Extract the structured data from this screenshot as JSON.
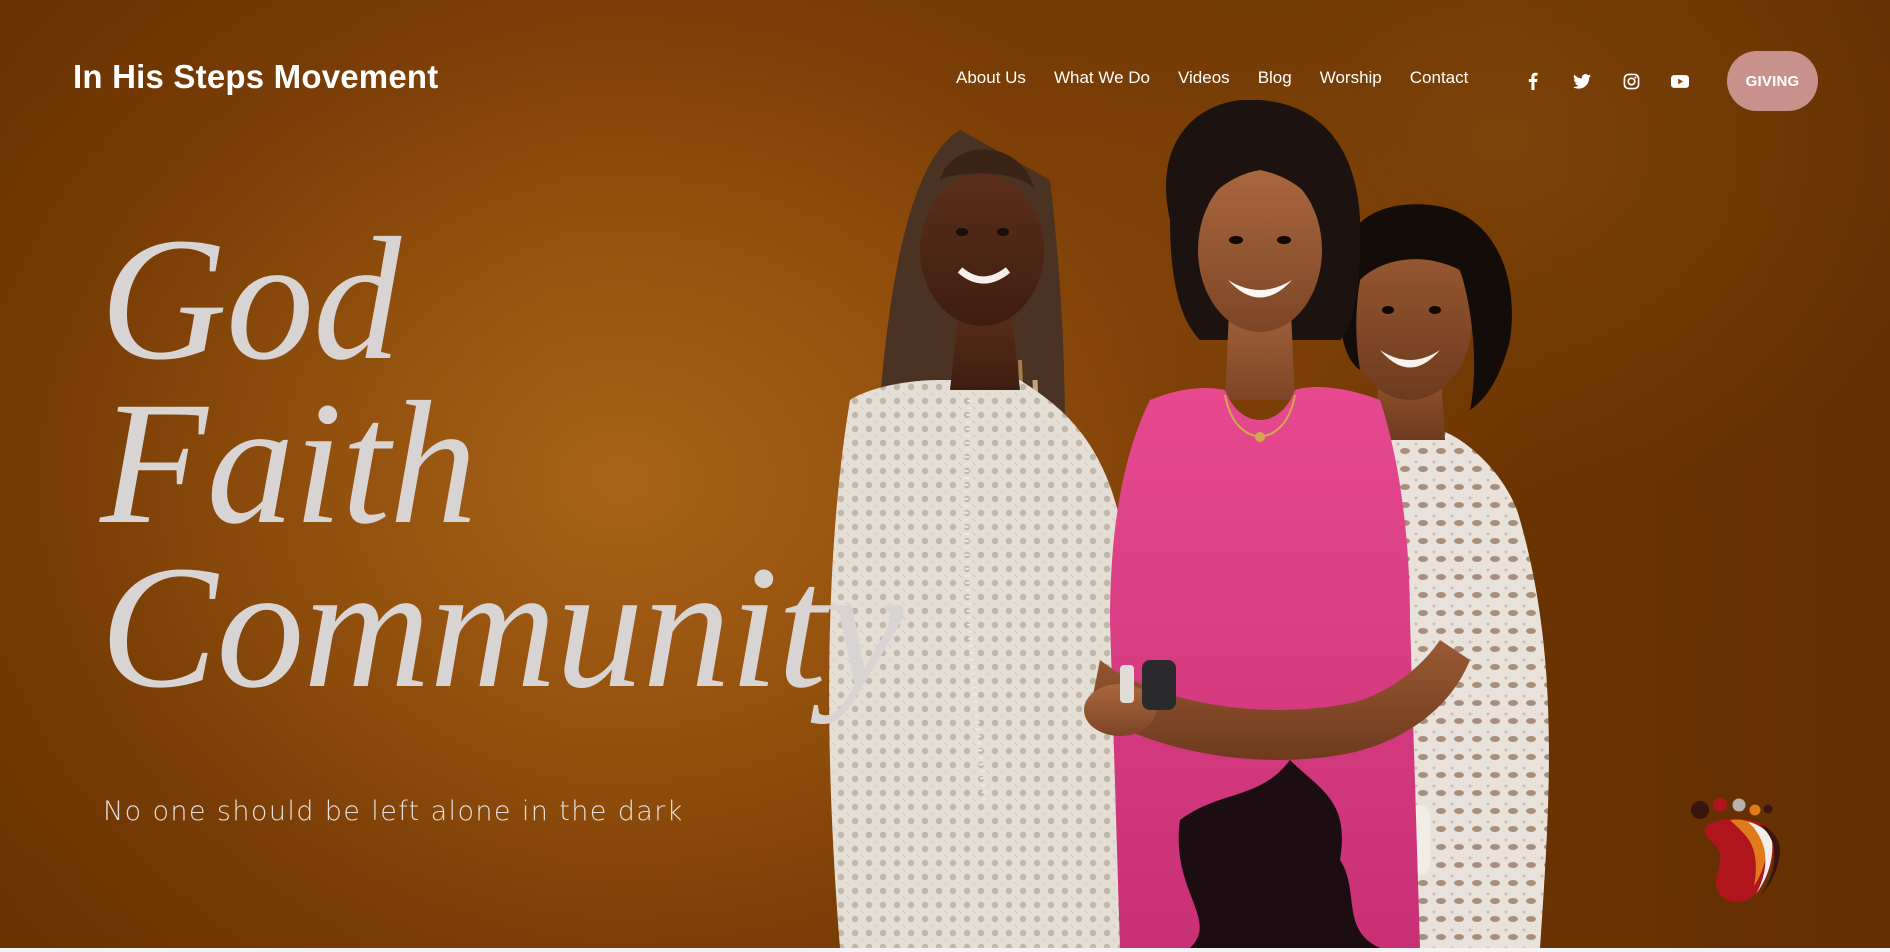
{
  "header": {
    "site_title": "In His Steps Movement",
    "nav": [
      {
        "label": "About Us"
      },
      {
        "label": "What We Do"
      },
      {
        "label": "Videos"
      },
      {
        "label": "Blog"
      },
      {
        "label": "Worship"
      },
      {
        "label": "Contact"
      }
    ],
    "social_icons": [
      "facebook-icon",
      "twitter-icon",
      "instagram-icon",
      "youtube-icon"
    ],
    "giving_label": "GIVING"
  },
  "hero": {
    "heading_lines": [
      "God",
      "Faith",
      "Community"
    ],
    "subheading": "No one should be left alone in the dark",
    "image_description_icon": "group-photo",
    "background_color": "#95520e"
  },
  "colors": {
    "text_light": "#ffffff",
    "heading": "#d8d4d3",
    "giving_button": "#c9918b",
    "logo_red": "#b0141c",
    "logo_orange": "#e07a1a",
    "logo_dark": "#3a1410"
  }
}
